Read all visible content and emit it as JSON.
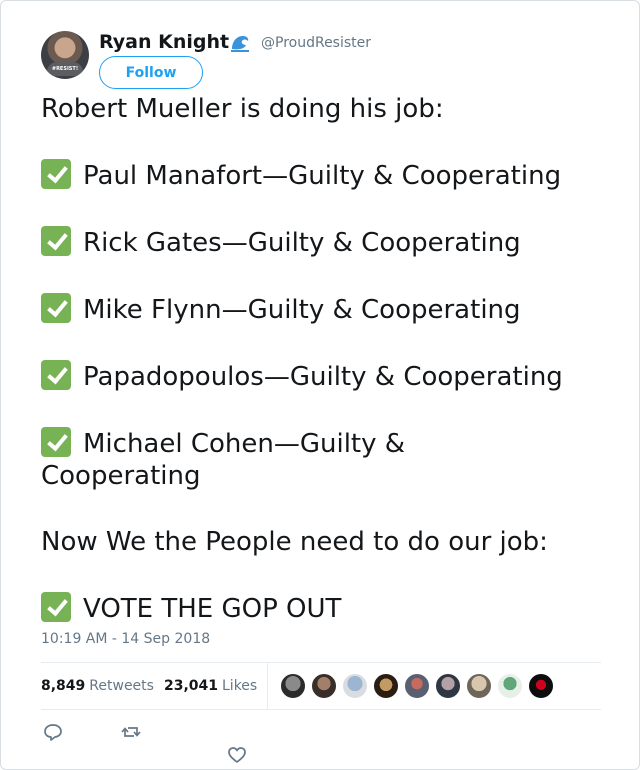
{
  "user": {
    "name": "Ryan Knight",
    "handle": "@ProudResister",
    "avatar_text": "#RESIST!"
  },
  "follow_label": "Follow",
  "tweet": {
    "lines": [
      "Robert Mueller is doing his job:",
      "Paul Manafort—Guilty & Cooperating",
      "Rick Gates—Guilty & Cooperating",
      "Mike Flynn—Guilty & Cooperating",
      "Papadopoulos—Guilty & Cooperating",
      "Michael Cohen—Guilty & Cooperating",
      "Now We the People need to do our job:",
      "VOTE THE GOP OUT"
    ]
  },
  "timestamp": "10:19 AM - 14 Sep 2018",
  "stats": {
    "retweets_count": "8,849",
    "retweets_label": "Retweets",
    "likes_count": "23,041",
    "likes_label": "Likes"
  },
  "colors": {
    "accent": "#1da1f2",
    "check": "#77b255",
    "muted": "#657786"
  },
  "icons": {
    "verified_badge": "wave-icon",
    "reply": "reply-icon",
    "retweet": "retweet-icon",
    "like": "heart-icon"
  }
}
